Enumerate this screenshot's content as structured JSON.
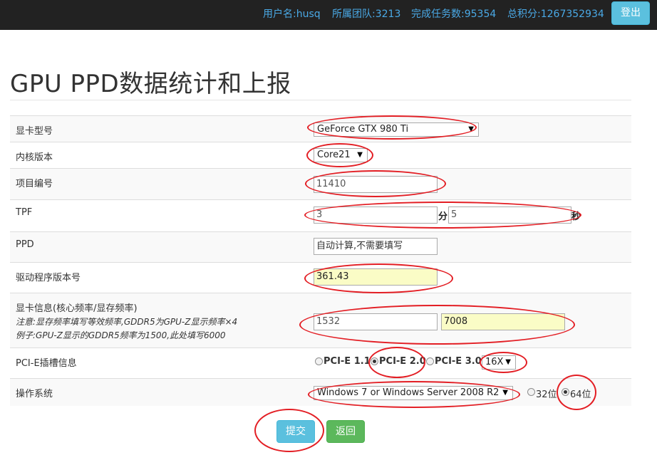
{
  "topbar": {
    "username": "用户名:husq",
    "team": "所属团队:3213",
    "tasks": "完成任务数:95354",
    "score": "总积分:1267352934",
    "logout_label": "登出"
  },
  "page_title": "GPU PPD数据统计和上报",
  "form": {
    "gpu_model": {
      "label": "显卡型号",
      "value": "GeForce GTX 980 Ti"
    },
    "core_version": {
      "label": "内核版本",
      "value": "Core21"
    },
    "project_id": {
      "label": "项目编号",
      "value": "11410"
    },
    "tpf": {
      "label": "TPF",
      "minutes": "3",
      "minutes_unit": "分",
      "seconds": "5",
      "seconds_unit": "秒"
    },
    "ppd": {
      "label": "PPD",
      "value": "自动计算,不需要填写"
    },
    "driver_version": {
      "label": "驱动程序版本号",
      "value": "361.43"
    },
    "gpu_info": {
      "label": "显卡信息(核心频率/显存频率)",
      "note1": "注意:显存频率填写等效频率,GDDR5为GPU-Z显示频率×4",
      "note2": "例子:GPU-Z显示的GDDR5频率为1500,此处填写6000",
      "core_clock": "1532",
      "mem_clock": "7008"
    },
    "pcie": {
      "label": "PCI-E插槽信息",
      "options": [
        "PCI-E 1.1",
        "PCI-E 2.0",
        "PCI-E 3.0"
      ],
      "selected": "PCI-E 2.0",
      "lanes": "16X"
    },
    "os": {
      "label": "操作系统",
      "value": "Windows 7 or Windows Server 2008 R2",
      "bit_options": [
        "32位",
        "64位"
      ],
      "bit_selected": "64位"
    }
  },
  "buttons": {
    "submit_label": "提交",
    "back_label": "返回"
  },
  "colors": {
    "annotation": "#e31e24",
    "submit": "#5bc0de",
    "back": "#5cb85c",
    "topbar": "#222222",
    "nav_text": "#4aa9e6"
  }
}
